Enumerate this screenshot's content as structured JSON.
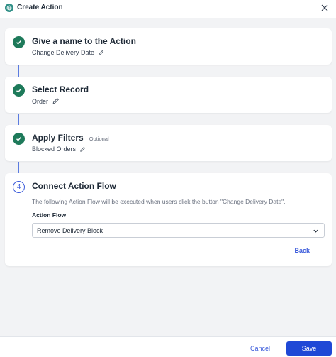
{
  "header": {
    "title": "Create Action",
    "app_icon": "globe-icon",
    "close_icon": "close-icon"
  },
  "steps": [
    {
      "status": "complete",
      "title": "Give a name to the Action",
      "value": "Change Delivery Date",
      "edit_icon": "pencil-icon"
    },
    {
      "status": "complete",
      "title": "Select Record",
      "value": "Order",
      "edit_icon": "pencil-icon"
    },
    {
      "status": "complete",
      "title": "Apply Filters",
      "tag": "Optional",
      "value": "Blocked Orders",
      "edit_icon": "pencil-icon"
    },
    {
      "status": "active",
      "number": "4",
      "title": "Connect Action Flow",
      "description": "The following Action Flow will be executed when users click the button \"Change Delivery Date\".",
      "field_label": "Action Flow",
      "select_value": "Remove Delivery Block",
      "back_label": "Back"
    }
  ],
  "footer": {
    "cancel_label": "Cancel",
    "save_label": "Save"
  },
  "colors": {
    "accent": "#1f48d6",
    "check_green": "#1e7a5a",
    "link_blue": "#3b5bdb",
    "background": "#f2f3f5"
  }
}
